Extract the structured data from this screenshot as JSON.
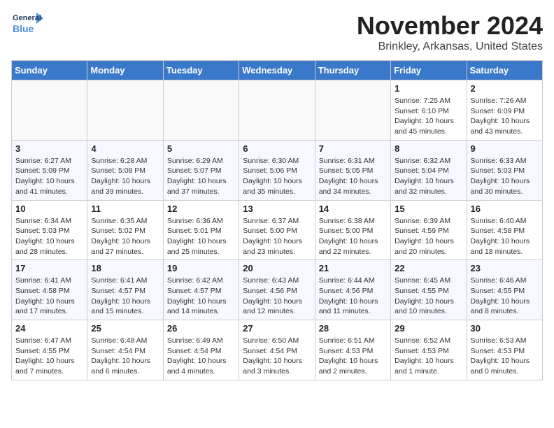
{
  "logo": {
    "line1": "General",
    "line2": "Blue"
  },
  "title": "November 2024",
  "location": "Brinkley, Arkansas, United States",
  "weekdays": [
    "Sunday",
    "Monday",
    "Tuesday",
    "Wednesday",
    "Thursday",
    "Friday",
    "Saturday"
  ],
  "weeks": [
    [
      {
        "day": "",
        "info": ""
      },
      {
        "day": "",
        "info": ""
      },
      {
        "day": "",
        "info": ""
      },
      {
        "day": "",
        "info": ""
      },
      {
        "day": "",
        "info": ""
      },
      {
        "day": "1",
        "info": "Sunrise: 7:25 AM\nSunset: 6:10 PM\nDaylight: 10 hours and 45 minutes."
      },
      {
        "day": "2",
        "info": "Sunrise: 7:26 AM\nSunset: 6:09 PM\nDaylight: 10 hours and 43 minutes."
      }
    ],
    [
      {
        "day": "3",
        "info": "Sunrise: 6:27 AM\nSunset: 5:09 PM\nDaylight: 10 hours and 41 minutes."
      },
      {
        "day": "4",
        "info": "Sunrise: 6:28 AM\nSunset: 5:08 PM\nDaylight: 10 hours and 39 minutes."
      },
      {
        "day": "5",
        "info": "Sunrise: 6:29 AM\nSunset: 5:07 PM\nDaylight: 10 hours and 37 minutes."
      },
      {
        "day": "6",
        "info": "Sunrise: 6:30 AM\nSunset: 5:06 PM\nDaylight: 10 hours and 35 minutes."
      },
      {
        "day": "7",
        "info": "Sunrise: 6:31 AM\nSunset: 5:05 PM\nDaylight: 10 hours and 34 minutes."
      },
      {
        "day": "8",
        "info": "Sunrise: 6:32 AM\nSunset: 5:04 PM\nDaylight: 10 hours and 32 minutes."
      },
      {
        "day": "9",
        "info": "Sunrise: 6:33 AM\nSunset: 5:03 PM\nDaylight: 10 hours and 30 minutes."
      }
    ],
    [
      {
        "day": "10",
        "info": "Sunrise: 6:34 AM\nSunset: 5:03 PM\nDaylight: 10 hours and 28 minutes."
      },
      {
        "day": "11",
        "info": "Sunrise: 6:35 AM\nSunset: 5:02 PM\nDaylight: 10 hours and 27 minutes."
      },
      {
        "day": "12",
        "info": "Sunrise: 6:36 AM\nSunset: 5:01 PM\nDaylight: 10 hours and 25 minutes."
      },
      {
        "day": "13",
        "info": "Sunrise: 6:37 AM\nSunset: 5:00 PM\nDaylight: 10 hours and 23 minutes."
      },
      {
        "day": "14",
        "info": "Sunrise: 6:38 AM\nSunset: 5:00 PM\nDaylight: 10 hours and 22 minutes."
      },
      {
        "day": "15",
        "info": "Sunrise: 6:39 AM\nSunset: 4:59 PM\nDaylight: 10 hours and 20 minutes."
      },
      {
        "day": "16",
        "info": "Sunrise: 6:40 AM\nSunset: 4:58 PM\nDaylight: 10 hours and 18 minutes."
      }
    ],
    [
      {
        "day": "17",
        "info": "Sunrise: 6:41 AM\nSunset: 4:58 PM\nDaylight: 10 hours and 17 minutes."
      },
      {
        "day": "18",
        "info": "Sunrise: 6:41 AM\nSunset: 4:57 PM\nDaylight: 10 hours and 15 minutes."
      },
      {
        "day": "19",
        "info": "Sunrise: 6:42 AM\nSunset: 4:57 PM\nDaylight: 10 hours and 14 minutes."
      },
      {
        "day": "20",
        "info": "Sunrise: 6:43 AM\nSunset: 4:56 PM\nDaylight: 10 hours and 12 minutes."
      },
      {
        "day": "21",
        "info": "Sunrise: 6:44 AM\nSunset: 4:56 PM\nDaylight: 10 hours and 11 minutes."
      },
      {
        "day": "22",
        "info": "Sunrise: 6:45 AM\nSunset: 4:55 PM\nDaylight: 10 hours and 10 minutes."
      },
      {
        "day": "23",
        "info": "Sunrise: 6:46 AM\nSunset: 4:55 PM\nDaylight: 10 hours and 8 minutes."
      }
    ],
    [
      {
        "day": "24",
        "info": "Sunrise: 6:47 AM\nSunset: 4:55 PM\nDaylight: 10 hours and 7 minutes."
      },
      {
        "day": "25",
        "info": "Sunrise: 6:48 AM\nSunset: 4:54 PM\nDaylight: 10 hours and 6 minutes."
      },
      {
        "day": "26",
        "info": "Sunrise: 6:49 AM\nSunset: 4:54 PM\nDaylight: 10 hours and 4 minutes."
      },
      {
        "day": "27",
        "info": "Sunrise: 6:50 AM\nSunset: 4:54 PM\nDaylight: 10 hours and 3 minutes."
      },
      {
        "day": "28",
        "info": "Sunrise: 6:51 AM\nSunset: 4:53 PM\nDaylight: 10 hours and 2 minutes."
      },
      {
        "day": "29",
        "info": "Sunrise: 6:52 AM\nSunset: 4:53 PM\nDaylight: 10 hours and 1 minute."
      },
      {
        "day": "30",
        "info": "Sunrise: 6:53 AM\nSunset: 4:53 PM\nDaylight: 10 hours and 0 minutes."
      }
    ]
  ]
}
